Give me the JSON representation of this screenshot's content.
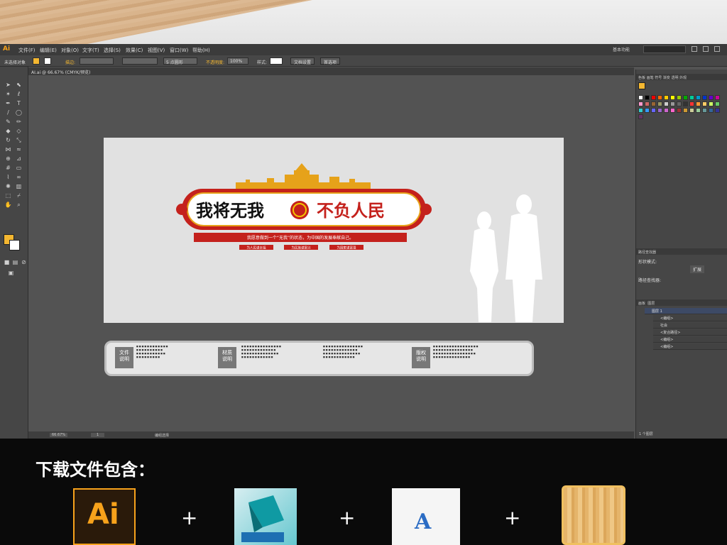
{
  "menubar": {
    "app_logo": "Ai",
    "items": [
      "文件(F)",
      "编辑(E)",
      "对象(O)",
      "文字(T)",
      "选择(S)",
      "效果(C)",
      "视图(V)",
      "窗口(W)",
      "帮助(H)"
    ],
    "workspace": "基本功能"
  },
  "control_bar": {
    "selection": "未选择对象",
    "stroke_label": "描边:",
    "brush_label": "5 点圆形",
    "opacity_label": "不透明度:",
    "opacity_value": "100%",
    "style_label": "样式:",
    "doc_setup": "文档设置",
    "prefs": "首选项"
  },
  "document": {
    "tab": "AI.ai @ 66.67% (CMYK/预览)",
    "zoom": "66.67%",
    "page": "1",
    "status": "编组选择"
  },
  "artwork": {
    "title_left": "我将无我",
    "title_right": "不负人民",
    "subtitle": "我愿意做到一个“无我”的状态，为中国的发展奉献自己。",
    "tags": [
      "为人民谋幸福",
      "为民族谋复兴",
      "为国家谋富强"
    ]
  },
  "info_board": {
    "tags": [
      "文件\n说明",
      "材质\n说明",
      "版权\n说明"
    ]
  },
  "right_panel": {
    "tabs_top": [
      "色板",
      "画笔",
      "符号",
      "渐变",
      "透明",
      "外观"
    ],
    "pathfinder": "路径查找器",
    "shape_modes": "形状模式:",
    "pathfinders": "路径查找器:",
    "expand": "扩展",
    "layers_tabs": [
      "画板",
      "图层"
    ],
    "layers": [
      "图层 1",
      "<编组>",
      "社会",
      "<复合路径>",
      "<编组>",
      "<编组>"
    ],
    "layer_count": "1 个图层"
  },
  "bottom": {
    "title": "下载文件包含：",
    "plus": "+"
  },
  "colors": {
    "fill": "#f4b731",
    "ui_dark": "#535353",
    "party_red": "#c4211c",
    "gold": "#e6a21a"
  }
}
